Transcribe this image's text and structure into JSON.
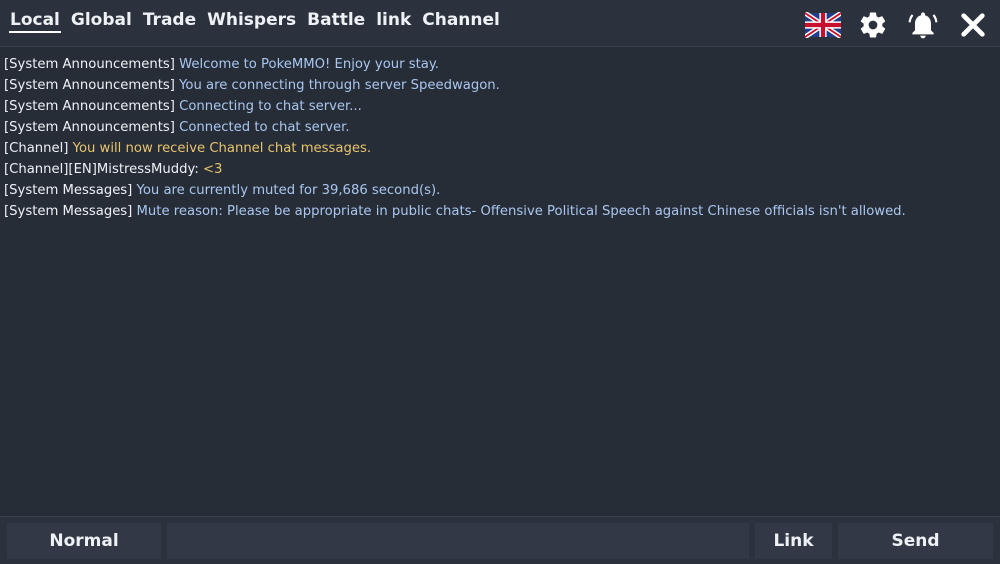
{
  "tabs": [
    {
      "label": "Local",
      "active": true
    },
    {
      "label": "Global"
    },
    {
      "label": "Trade"
    },
    {
      "label": "Whispers"
    },
    {
      "label": "Battle"
    },
    {
      "label": "link"
    },
    {
      "label": "Channel"
    }
  ],
  "toolbar_icons": [
    "uk-flag-icon",
    "gear-icon",
    "bell-icon",
    "close-icon"
  ],
  "messages": [
    {
      "tag": "[System Announcements]",
      "text": "Welcome to PokeMMO! Enjoy your stay.",
      "color": "#a9c6ef"
    },
    {
      "tag": "[System Announcements]",
      "text": "You are connecting through server Speedwagon.",
      "color": "#a9c6ef"
    },
    {
      "tag": "[System Announcements]",
      "text": "Connecting to chat server...",
      "color": "#a9c6ef"
    },
    {
      "tag": "[System Announcements]",
      "text": "Connected to chat server.",
      "color": "#a9c6ef"
    },
    {
      "tag": "[Channel]",
      "text": "You will now receive Channel chat messages.",
      "color": "#e7c46e"
    },
    {
      "tag": "[Channel][EN]",
      "sender": "MistressMuddy:",
      "text": "<3",
      "color": "#e7c46e"
    },
    {
      "tag": "[System Messages]",
      "text": "You are currently muted for 39,686 second(s).",
      "color": "#a9c6ef"
    },
    {
      "tag": "[System Messages]",
      "text": "Mute reason: Please be appropriate in public chats- Offensive Political Speech against Chinese officials isn't allowed.",
      "color": "#a9c6ef"
    }
  ],
  "bottom": {
    "mode_label": "Normal",
    "input_value": "",
    "link_label": "Link",
    "send_label": "Send"
  },
  "colors": {
    "background": "#272d37",
    "bar": "#2c323d",
    "button": "#323845",
    "system_text": "#a9c6ef",
    "channel_text": "#e7c46e"
  }
}
